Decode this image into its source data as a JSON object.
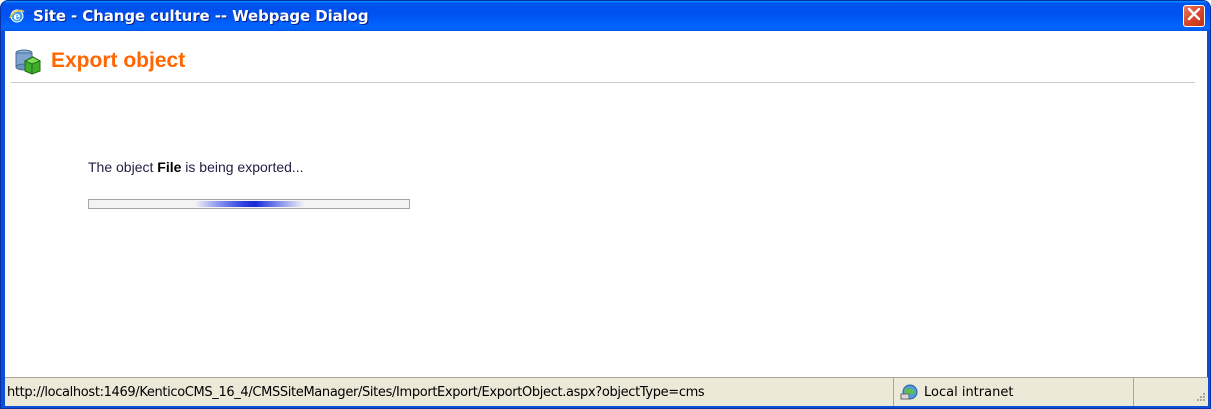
{
  "window": {
    "title": "Site - Change culture -- Webpage Dialog",
    "icon": "ie-icon",
    "close_icon": "close-icon"
  },
  "header": {
    "title": "Export object",
    "icon": "export-object-icon"
  },
  "message": {
    "prefix": "The object ",
    "object_name": "File",
    "suffix": " is being exported..."
  },
  "progress": {
    "type": "indeterminate",
    "marquee_start_fraction": 0.33,
    "marquee_end_fraction": 0.67
  },
  "statusbar": {
    "url": "http://localhost:1469/KenticoCMS_16_4/CMSSiteManager/Sites/ImportExport/ExportObject.aspx?objectType=cms",
    "zone_label": "Local intranet",
    "zone_icon": "local-intranet-icon"
  },
  "colors": {
    "titlebar": "#0054e3",
    "header_title": "#ff6600",
    "close_button": "#d8472a",
    "progress_marquee": "#1a2ad8",
    "statusbar_bg": "#ece9d8"
  }
}
